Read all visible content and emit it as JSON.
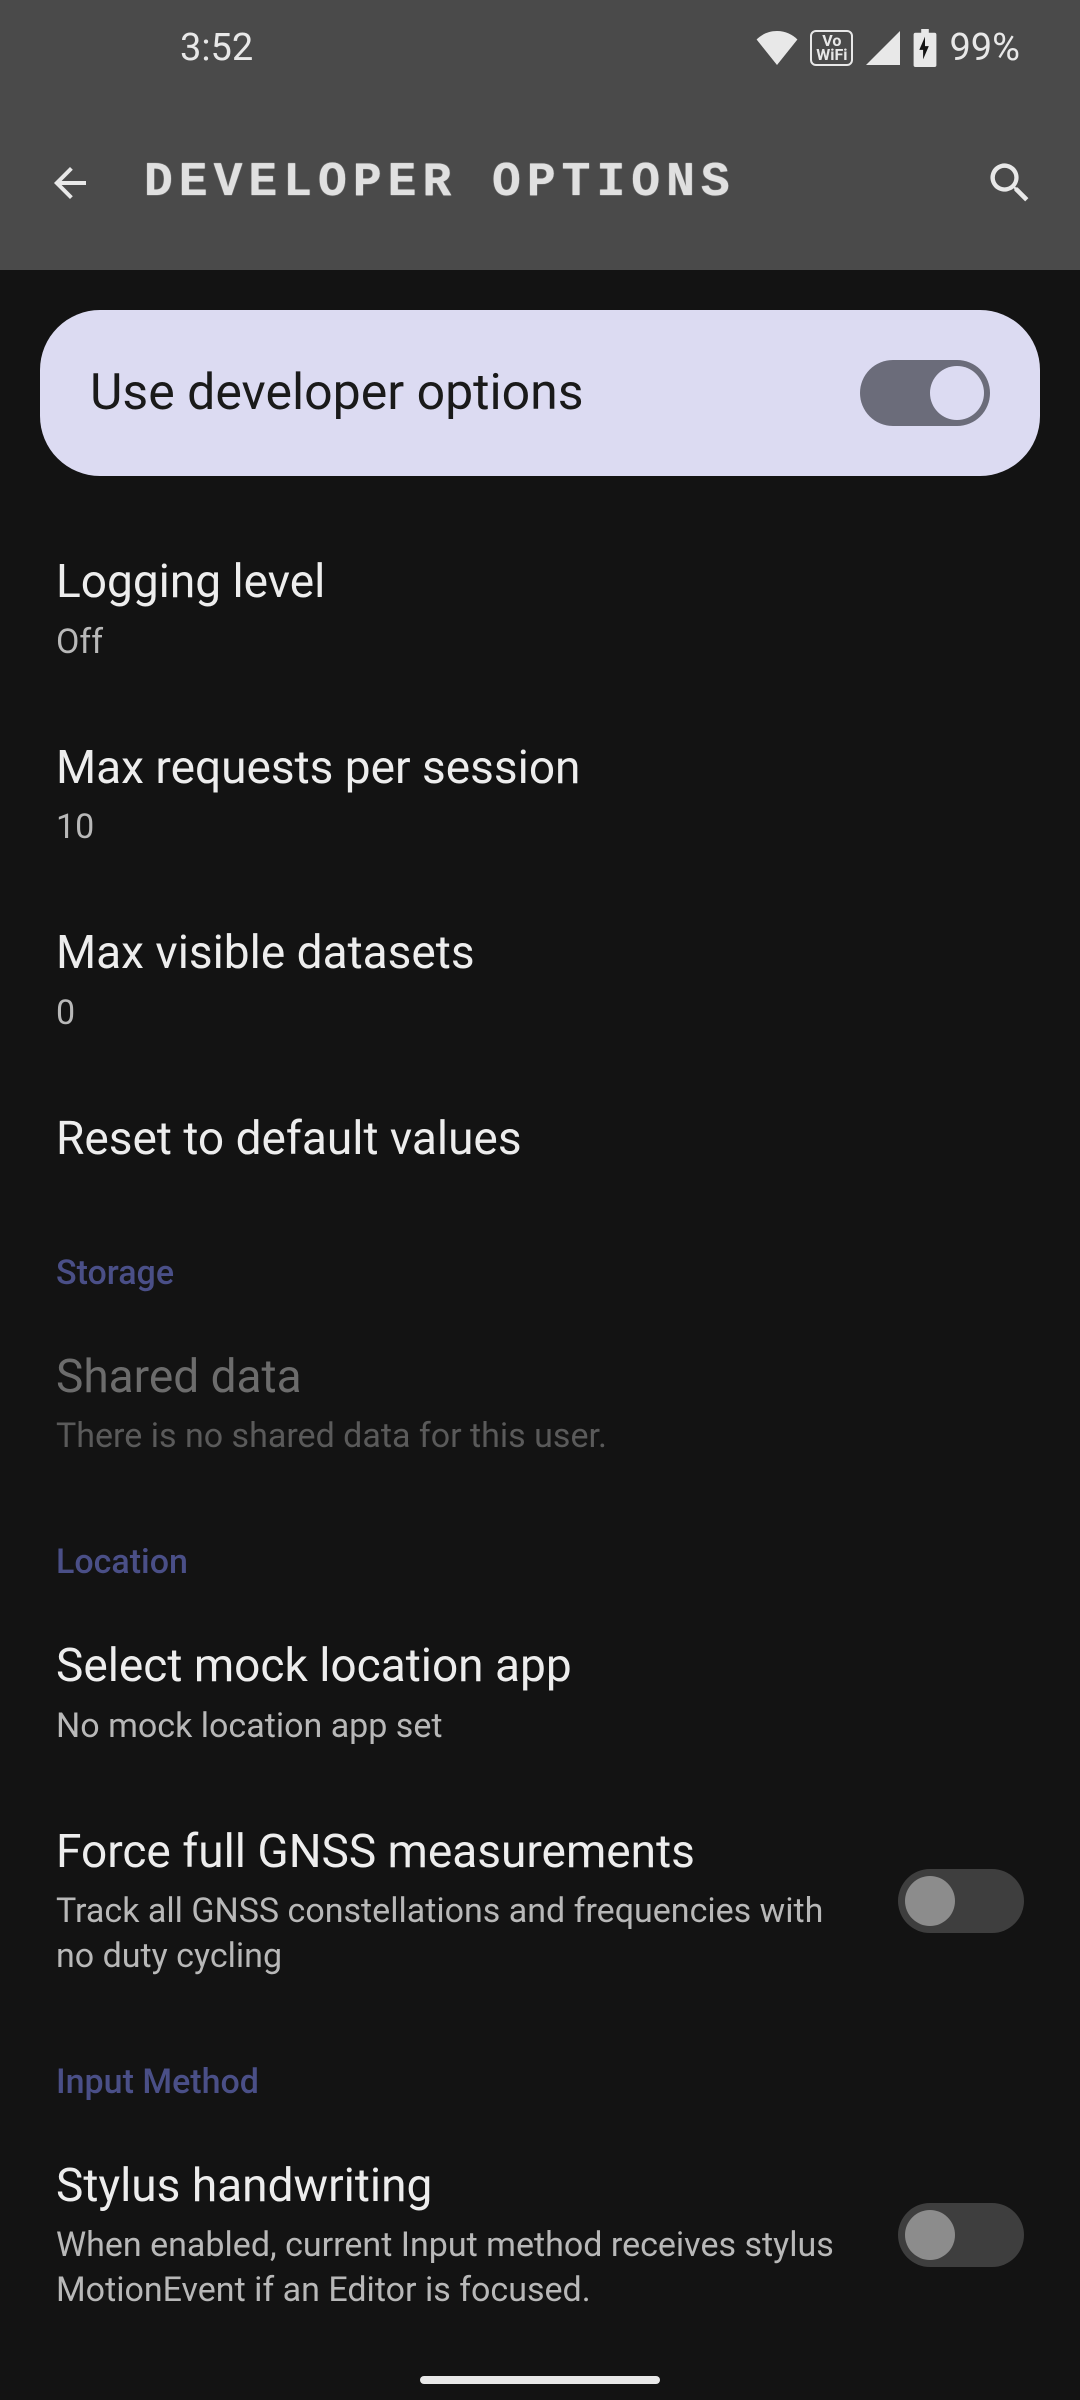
{
  "status": {
    "time": "3:52",
    "battery": "99%"
  },
  "header": {
    "title": "DEVELOPER OPTIONS"
  },
  "hero": {
    "label": "Use developer options",
    "enabled": true
  },
  "settings": {
    "logging": {
      "title": "Logging level",
      "sub": "Off"
    },
    "maxreq": {
      "title": "Max requests per session",
      "sub": "10"
    },
    "maxds": {
      "title": "Max visible datasets",
      "sub": "0"
    },
    "reset": {
      "title": "Reset to default values"
    },
    "shared": {
      "title": "Shared data",
      "sub": "There is no shared data for this user."
    },
    "mock": {
      "title": "Select mock location app",
      "sub": "No mock location app set"
    },
    "gnss": {
      "title": "Force full GNSS measurements",
      "sub": "Track all GNSS constellations and frequencies with no duty cycling"
    },
    "stylus": {
      "title": "Stylus handwriting",
      "sub": "When enabled, current Input method receives stylus MotionEvent if an Editor is focused."
    }
  },
  "sections": {
    "storage": "Storage",
    "location": "Location",
    "input": "Input Method"
  }
}
